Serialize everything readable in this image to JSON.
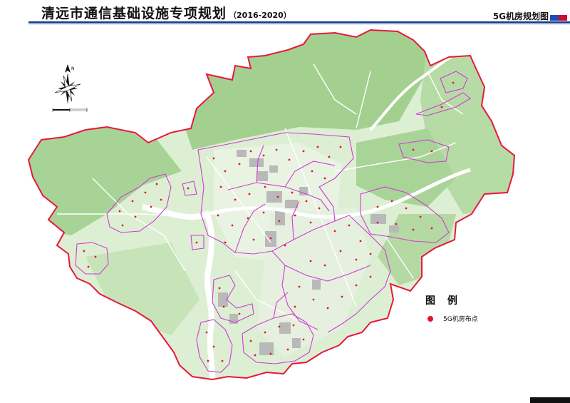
{
  "header": {
    "title": "清远市通信基础设施专项规划",
    "years": "（2016-2020）",
    "map_name": "5G机房规划图"
  },
  "legend": {
    "title": "图 例",
    "items": [
      {
        "label": "5G机房布点",
        "color": "#e0162b",
        "icon": "red-dot-icon"
      }
    ]
  },
  "colors": {
    "boundary": "#e8173d",
    "district_lines": "#d23ad8",
    "forest": "#9ccc8a",
    "green_light": "#d6ecca",
    "urban": "#b5b5b5",
    "header_accent": "#0f3d8c",
    "badge_blue": "#1f4fb5",
    "badge_red": "#c8102e"
  },
  "map": {
    "compass": "north-arrow-rose-icon",
    "scale_bar": "scale-bar-icon"
  }
}
